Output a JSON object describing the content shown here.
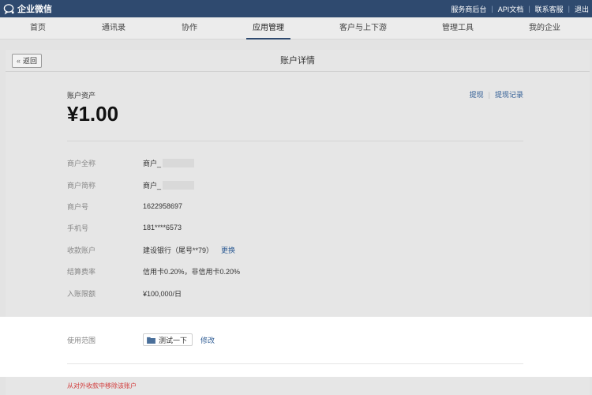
{
  "topbar": {
    "app_name": "企业微信",
    "links": [
      "服务商后台",
      "API文档",
      "联系客服",
      "退出"
    ],
    "colors": {
      "background": "#2f4a6f",
      "text": "#ffffff"
    }
  },
  "nav": {
    "items": [
      "首页",
      "通讯录",
      "协作",
      "应用管理",
      "客户与上下游",
      "管理工具",
      "我的企业"
    ],
    "active": "应用管理"
  },
  "header": {
    "back_label": "返回",
    "title": "账户详情"
  },
  "account": {
    "asset_label": "账户资产",
    "asset_value": "¥1.00",
    "withdraw_label": "提现",
    "withdraw_record_label": "提现记录"
  },
  "fields": [
    {
      "label": "商户全称",
      "value": "商户_",
      "masked": true
    },
    {
      "label": "商户简称",
      "value": "商户_",
      "masked": true
    },
    {
      "label": "商户号",
      "value": "1622958697"
    },
    {
      "label": "手机号",
      "value": "181****6573"
    },
    {
      "label": "收款账户",
      "value": "建设银行（尾号**79）",
      "action": "更换"
    },
    {
      "label": "结算费率",
      "value": "信用卡0.20%，非信用卡0.20%"
    },
    {
      "label": "入账限额",
      "value": "¥100,000/日"
    }
  ],
  "scope": {
    "label": "使用范围",
    "tag": "测试一下",
    "edit_label": "修改"
  },
  "footer": {
    "remove_label": "从对外收款中移除该账户",
    "color": "#d23b3b"
  }
}
